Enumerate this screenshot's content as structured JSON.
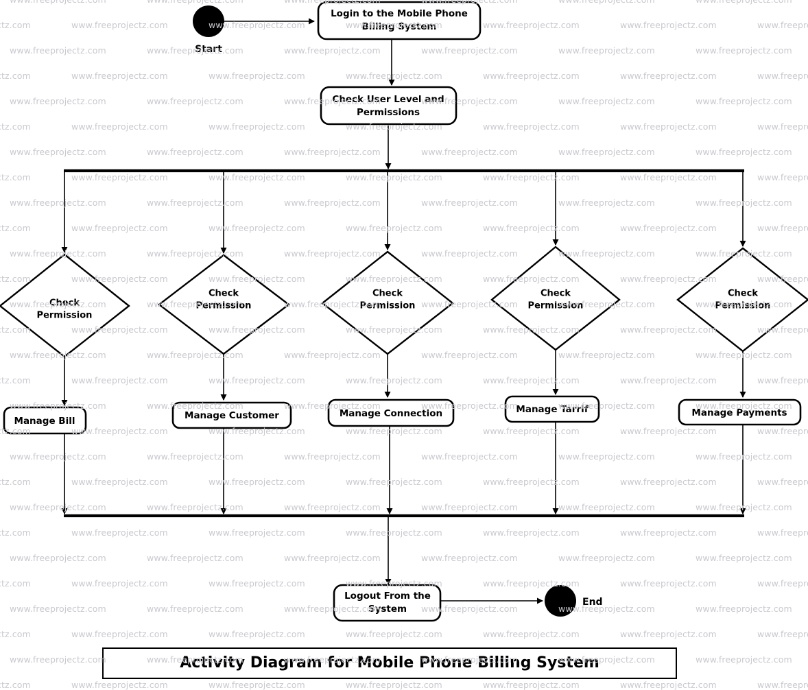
{
  "diagram": {
    "title": "Activity Diagram for Mobile Phone Billing System",
    "watermark_text": "www.freeprojectz.com",
    "start_label": "Start",
    "end_label": "End",
    "nodes": {
      "login": "Login to the Mobile Phone Billing System",
      "check_user_level": "Check User Level and Permissions",
      "logout": "Logout From the System"
    },
    "decisions": [
      {
        "line1": "Check",
        "line2": "Permission"
      },
      {
        "line1": "Check",
        "line2": "Permission"
      },
      {
        "line1": "Check",
        "line2": "Permission"
      },
      {
        "line1": "Check",
        "line2": "Permission"
      },
      {
        "line1": "Check",
        "line2": "Permission"
      }
    ],
    "activities": [
      "Manage Bill",
      "Manage Customer",
      "Manage Connection",
      "Manage Tarrif",
      "Manage Payments"
    ],
    "colors": {
      "stroke": "#000000",
      "fill": "#ffffff",
      "watermark": "#c9c9cf"
    }
  }
}
